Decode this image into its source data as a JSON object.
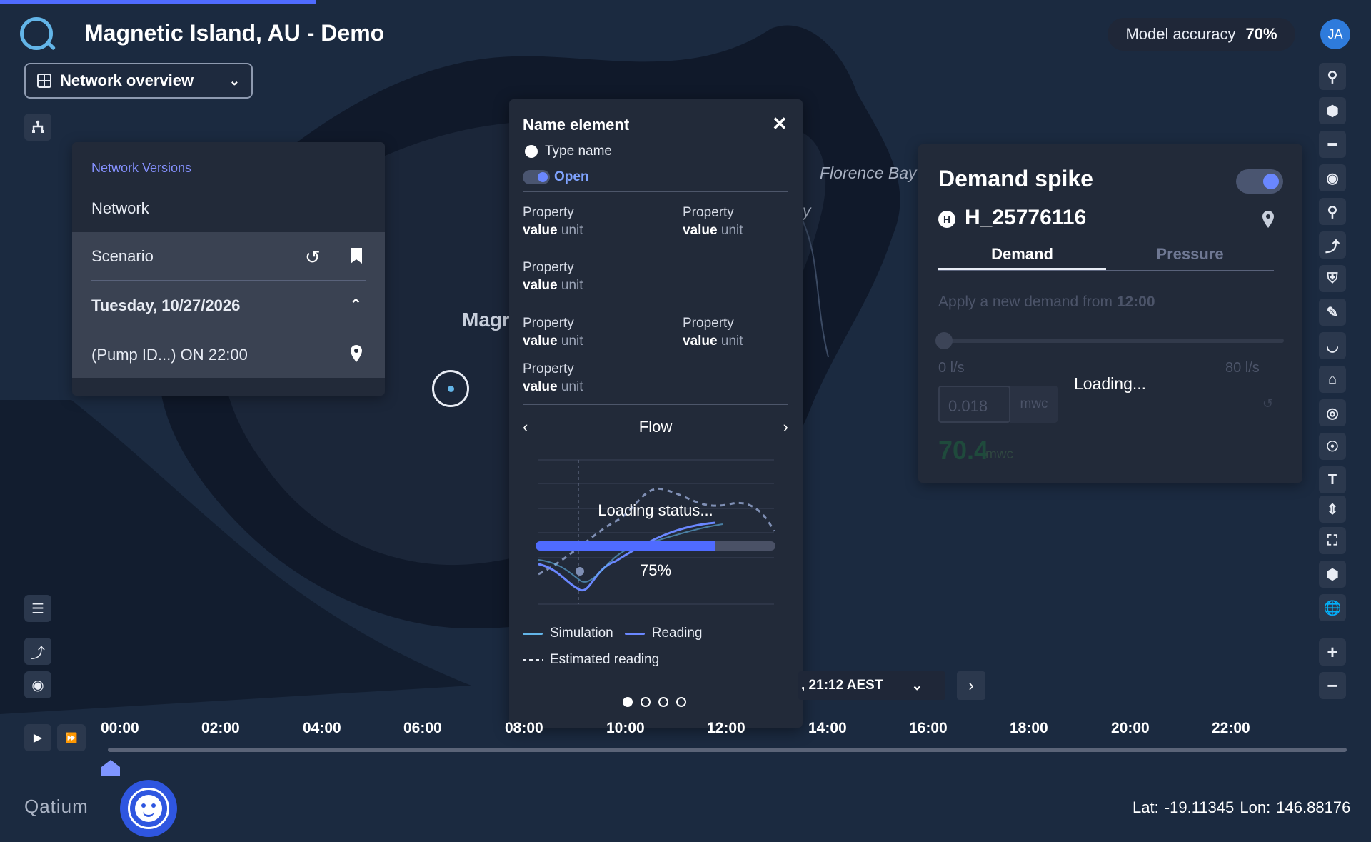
{
  "app": {
    "title": "Magnetic Island, AU - Demo",
    "view_select": "Network overview",
    "accuracy_label": "Model accuracy",
    "accuracy_value": "70%",
    "avatar_initials": "JA",
    "brand": "Qatium",
    "top_progress": 0.23
  },
  "map": {
    "labels": {
      "florence_bay": "Florence Bay",
      "magnetic": "Magr",
      "partial": "y"
    },
    "coords": "Lat: -19.11345   Lon: 146.88176"
  },
  "versions": {
    "header": "Network Versions",
    "network": "Network",
    "scenario": "Scenario",
    "date": "Tuesday, 10/27/2026",
    "event": "(Pump ID...)  ON 22:00"
  },
  "element_popup": {
    "title": "Name element",
    "type_name": "Type name",
    "status": "Open",
    "properties": [
      {
        "label": "Property",
        "value": "value",
        "unit": "unit"
      },
      {
        "label": "Property",
        "value": "value",
        "unit": "unit"
      },
      {
        "label": "Property",
        "value": "value",
        "unit": "unit"
      },
      {
        "label": "Property",
        "value": "value",
        "unit": "unit"
      },
      {
        "label": "Property",
        "value": "value",
        "unit": "unit"
      },
      {
        "label": "Property",
        "value": "value",
        "unit": "unit"
      }
    ],
    "chart_title": "Flow",
    "loading_text": "Loading status...",
    "progress_fraction": 0.75,
    "progress_label": "75%",
    "legend": {
      "simulation": "Simulation",
      "reading": "Reading",
      "estimated": "Estimated reading"
    },
    "pages": 4,
    "active_page": 0,
    "colors": {
      "simulation": "#63b5e8",
      "reading": "#6a87ff",
      "estimated": "#7f8fb4"
    }
  },
  "demand_panel": {
    "title": "Demand spike",
    "element_id": "H_25776116",
    "tabs": [
      "Demand",
      "Pressure"
    ],
    "active_tab": 0,
    "apply_text": "Apply a new demand from",
    "apply_time": "12:00",
    "min_label": "0 l/s",
    "max_label": "80 l/s",
    "loading": "Loading...",
    "input_value": "0.018",
    "input_unit": "mwc",
    "result_value": "70.4",
    "result_unit": "mwc"
  },
  "timeline": {
    "date_display": ", 21:12 AEST",
    "hours": [
      "00:00",
      "02:00",
      "04:00",
      "06:00",
      "08:00",
      "10:00",
      "12:00",
      "14:00",
      "16:00",
      "18:00",
      "20:00",
      "22:00"
    ]
  },
  "right_tools": [
    "search-icon",
    "hexagon-icon",
    "valve-icon",
    "pump-icon",
    "pipe-search-icon",
    "route-icon",
    "shield-icon",
    "chart-edit-icon",
    "gauge-icon",
    "house-plus-icon",
    "meter-icon",
    "target-icon",
    "text-icon",
    "sort-icon",
    "fullscreen-icon",
    "cube-icon",
    "globe-icon"
  ]
}
